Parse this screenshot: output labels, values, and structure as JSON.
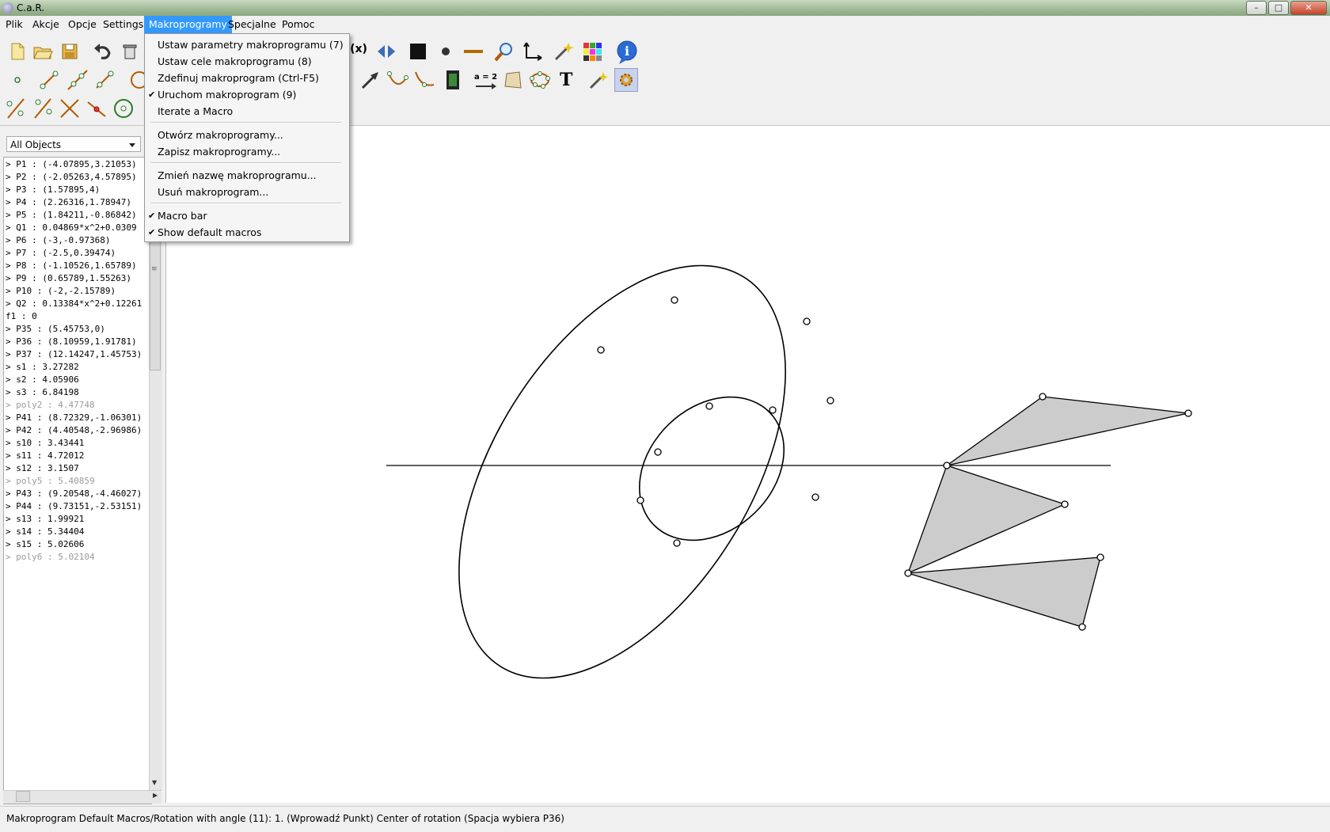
{
  "window": {
    "title": "C.a.R."
  },
  "menubar": {
    "items": [
      "Plik",
      "Akcje",
      "Opcje",
      "Settings",
      "Makroprogramy",
      "Specjalne",
      "Pomoc"
    ],
    "active": "Makroprogramy"
  },
  "dropdown": {
    "group1": [
      {
        "label": "Ustaw parametry makroprogramu (7)",
        "checked": false
      },
      {
        "label": "Ustaw cele makroprogramu (8)",
        "checked": false
      },
      {
        "label": "Zdefinuj makroprogram (Ctrl-F5)",
        "checked": false
      },
      {
        "label": "Uruchom makroprogram (9)",
        "checked": true
      },
      {
        "label": "Iterate a Macro",
        "checked": false
      }
    ],
    "group2": [
      {
        "label": "Otwórz makroprogramy...",
        "checked": false
      },
      {
        "label": "Zapisz makroprogramy...",
        "checked": false
      }
    ],
    "group3": [
      {
        "label": "Zmień nazwę makroprogramu...",
        "checked": false
      },
      {
        "label": "Usuń makroprogram...",
        "checked": false
      }
    ],
    "group4": [
      {
        "label": "Macro bar",
        "checked": true
      },
      {
        "label": "Show default macros",
        "checked": true
      }
    ],
    "check_glyph": "✔"
  },
  "toolbar": {
    "fx_label": "f(x)",
    "a2_label": "a = 2",
    "text_tool_label": "T",
    "info_label": "i"
  },
  "object_panel": {
    "filter": "All Objects",
    "objects": [
      {
        "text": "> P1 : (-4.07895,3.21053)",
        "dim": false
      },
      {
        "text": "> P2 : (-2.05263,4.57895)",
        "dim": false
      },
      {
        "text": "> P3 : (1.57895,4)",
        "dim": false
      },
      {
        "text": "> P4 : (2.26316,1.78947)",
        "dim": false
      },
      {
        "text": "> P5 : (1.84211,-0.86842)",
        "dim": false
      },
      {
        "text": "> Q1 : 0.04869*x^2+0.0309",
        "dim": false
      },
      {
        "text": "> P6 : (-3,-0.97368)",
        "dim": false
      },
      {
        "text": "> P7 : (-2.5,0.39474)",
        "dim": false
      },
      {
        "text": "> P8 : (-1.10526,1.65789)",
        "dim": false
      },
      {
        "text": "> P9 : (0.65789,1.55263)",
        "dim": false
      },
      {
        "text": "> P10 : (-2,-2.15789)",
        "dim": false
      },
      {
        "text": "> Q2 : 0.13384*x^2+0.12261",
        "dim": false
      },
      {
        "text": "f1 : 0",
        "dim": false
      },
      {
        "text": "> P35 : (5.45753,0)",
        "dim": false
      },
      {
        "text": "> P36 : (8.10959,1.91781)",
        "dim": false
      },
      {
        "text": "> P37 : (12.14247,1.45753)",
        "dim": false
      },
      {
        "text": "> s1 : 3.27282",
        "dim": false
      },
      {
        "text": "> s2 : 4.05906",
        "dim": false
      },
      {
        "text": "> s3 : 6.84198",
        "dim": false
      },
      {
        "text": "> poly2 : 4.47748",
        "dim": true
      },
      {
        "text": "> P41 : (8.72329,-1.06301)",
        "dim": false
      },
      {
        "text": "> P42 : (4.40548,-2.96986)",
        "dim": false
      },
      {
        "text": "> s10 : 3.43441",
        "dim": false
      },
      {
        "text": "> s11 : 4.72012",
        "dim": false
      },
      {
        "text": "> s12 : 3.1507",
        "dim": false
      },
      {
        "text": "> poly5 : 5.40859",
        "dim": true
      },
      {
        "text": "> P43 : (9.20548,-4.46027)",
        "dim": false
      },
      {
        "text": "> P44 : (9.73151,-2.53151)",
        "dim": false
      },
      {
        "text": "> s13 : 1.99921",
        "dim": false
      },
      {
        "text": "> s14 : 5.34404",
        "dim": false
      },
      {
        "text": "> s15 : 5.02606",
        "dim": false
      },
      {
        "text": "> poly6 : 5.02104",
        "dim": true
      }
    ]
  },
  "status": {
    "text": "Makroprogram Default Macros/Rotation with angle (11): 1. (Wprowadź Punkt) Center of rotation  (Spacja wybiera P36)"
  },
  "colors": {
    "menu_highlight": "#3399ff",
    "polygon_fill": "#cccccc",
    "stroke": "#000000"
  }
}
